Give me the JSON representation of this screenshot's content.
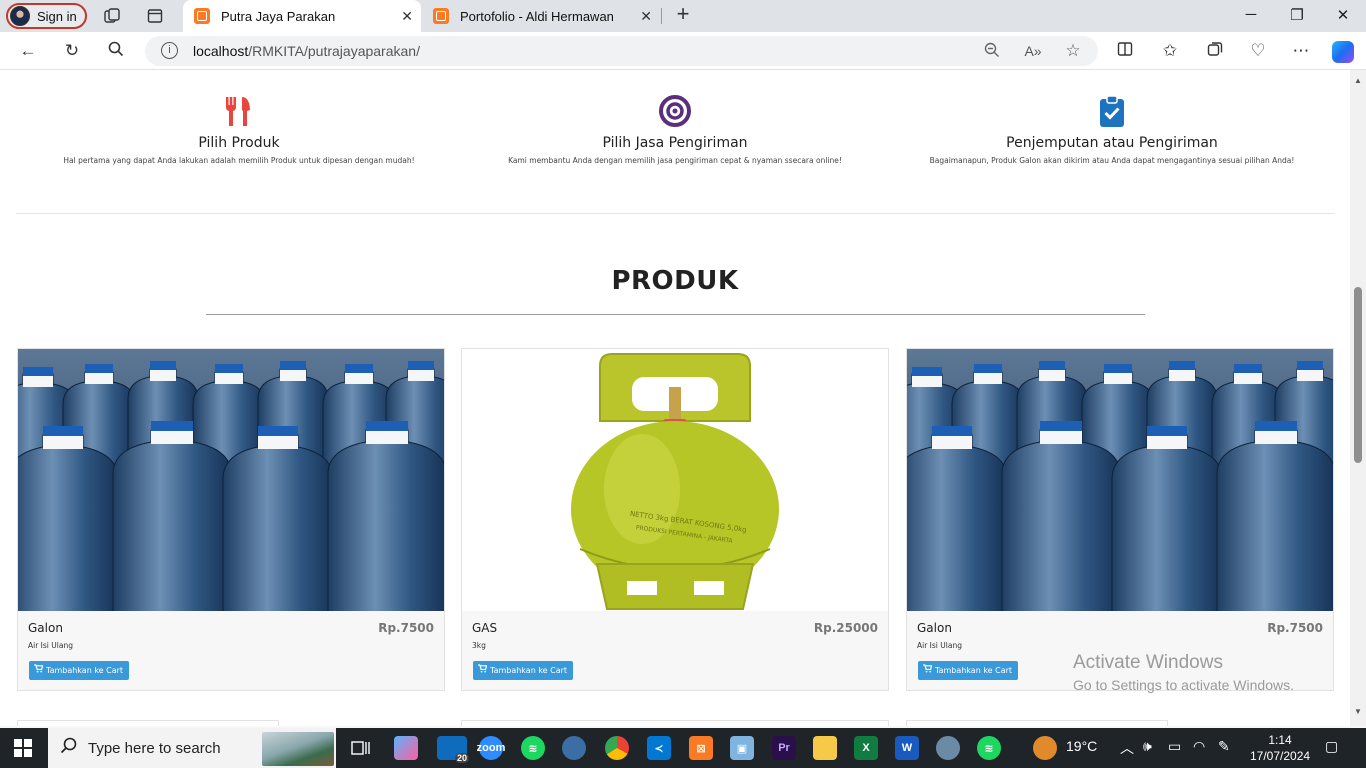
{
  "browser": {
    "profile_label": "Sign in",
    "tabs": [
      {
        "title": "Putra Jaya Parakan",
        "active": true
      },
      {
        "title": "Portofolio - Aldi Hermawan",
        "active": false
      }
    ],
    "url_host": "localhost",
    "url_path": "/RMKITA/putrajayaparakan/"
  },
  "features": [
    {
      "icon": "utensils-icon",
      "title": "Pilih Produk",
      "desc": "Hal pertama yang dapat Anda lakukan adalah memilih Produk untuk dipesan dengan mudah!"
    },
    {
      "icon": "target-icon",
      "title": "Pilih Jasa Pengiriman",
      "desc": "Kami membantu Anda dengan memilih jasa pengiriman cepat & nyaman ssecara online!"
    },
    {
      "icon": "clipboard-check-icon",
      "title": "Penjemputan atau Pengiriman",
      "desc": "Bagaimanapun, Produk Galon akan dikirim atau Anda dapat mengagantinya sesuai pilihan Anda!"
    }
  ],
  "produk": {
    "title": "PRODUK",
    "cards": [
      {
        "name": "Galon",
        "price": "Rp.7500",
        "desc": "Air Isi Ulang",
        "button": "Tambahkan ke Cart",
        "image": "water-gallons"
      },
      {
        "name": "GAS",
        "price": "Rp.25000",
        "desc": "3kg",
        "button": "Tambahkan ke Cart",
        "image": "lpg-cylinder"
      },
      {
        "name": "Galon",
        "price": "Rp.7500",
        "desc": "Air Isi Ulang",
        "button": "Tambahkan ke Cart",
        "image": "water-gallons"
      }
    ]
  },
  "watermark": {
    "line1": "Activate Windows",
    "line2": "Go to Settings to activate Windows."
  },
  "taskbar": {
    "search_placeholder": "Type here to search",
    "weather": "19°C",
    "time": "1:14",
    "date": "17/07/2024",
    "badge_count": "20"
  },
  "colors": {
    "accent_red": "#e8453c",
    "target_purple": "#5b2f7a",
    "clipboard_blue": "#1e73be",
    "button_blue": "#3a9ad9",
    "gas_green": "#b7c627"
  }
}
